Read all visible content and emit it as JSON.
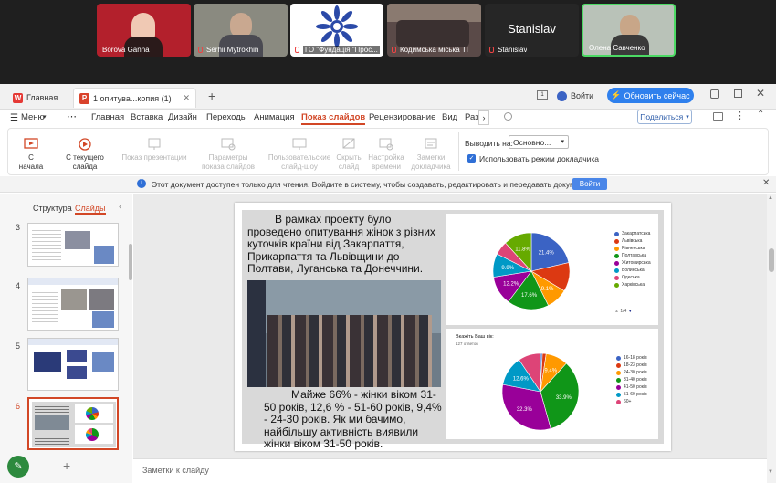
{
  "conference": {
    "participants": [
      {
        "name": "Borova Ganna",
        "bg": "#b3202c"
      },
      {
        "name": "Serhii Mytrokhin",
        "bg": "#8a8a80"
      },
      {
        "name": "ГО \"Фундація \"Прос...",
        "bg": "#ffffff"
      },
      {
        "name": "Кодимська міська ТГ",
        "bg": "#5a4a48"
      },
      {
        "name": "Stanislav",
        "bg": "#262626",
        "big": "Stanislav"
      },
      {
        "name": "Олена Савченко",
        "bg": "#b9c2b8"
      }
    ]
  },
  "tabs": [
    {
      "label": "Главная"
    },
    {
      "label": "1 опитува...копия (1)"
    }
  ],
  "login": "Войти",
  "update": "Обновить сейчас",
  "ribbon_tabs": [
    "Меню",
    "Главная",
    "Вставка",
    "Дизайн",
    "Переходы",
    "Анимация",
    "Показ слайдов",
    "Рецензирование",
    "Вид",
    "Раз"
  ],
  "share": "Поделиться",
  "ribbon": {
    "from_start": "С начала",
    "from_current": "С текущего слайда",
    "present": "Показ презентации",
    "params": [
      "Параметры",
      "показа слайдов"
    ],
    "custom": [
      "Пользовательские",
      "слайд-шоу"
    ],
    "hide": [
      "Скрыть",
      "слайд"
    ],
    "timings": [
      "Настройка",
      "времени"
    ],
    "notes": [
      "Заметки",
      "докладчика"
    ],
    "output_label": "Выводить на:",
    "output_value": "Основно...",
    "presenter": "Использовать режим докладчика"
  },
  "info": "Этот документ доступен только для чтения. Войдите в систему, чтобы создавать, редактировать и передавать документы.",
  "info_button": "Войти",
  "panel": {
    "structure": "Структура",
    "slides": "Слайды",
    "numbers": [
      "3",
      "4",
      "5",
      "6"
    ]
  },
  "slide": {
    "top_text": "В рамках проекту було проведено опитування жінок з різних куточків країни від Закарпаття, Прикарпаття та Львівщини до Полтави, Луганська та Донеччини.",
    "bottom_text": "Майже 66% - жінки віком 31-50 років, 12,6 % - 51-60 років, 9,4% - 24-30 років. Як ми бачимо, найбільшу активність виявили жінки віком 31-50 років.",
    "chart1": {
      "slices": [
        {
          "name": "Закарпатська",
          "value": 21.4,
          "color": "#3b63c4",
          "label": "21.4%"
        },
        {
          "name": "Львівська",
          "value": 12.2,
          "color": "#dc3912",
          "label": ""
        },
        {
          "name": "Рівненська",
          "value": 9.1,
          "color": "#ff9900",
          "label": "9.1%"
        },
        {
          "name": "Полтавська",
          "value": 17.6,
          "color": "#109618",
          "label": "17.6%"
        },
        {
          "name": "Житомирська",
          "value": 12.2,
          "color": "#990099",
          "label": "12.2%"
        },
        {
          "name": "Волинська",
          "value": 9.9,
          "color": "#0099c6",
          "label": "9.9%"
        },
        {
          "name": "Одеська",
          "value": 5.8,
          "color": "#dd4477",
          "label": ""
        },
        {
          "name": "Харківська",
          "value": 11.8,
          "color": "#66aa00",
          "label": "11.8%"
        }
      ],
      "pager": "1/4"
    },
    "chart2": {
      "title": "Вкажіть Ваш вік:",
      "subtitle": "127 ответов",
      "slices": [
        {
          "name": "16-18 років",
          "value": 0.8,
          "color": "#3b63c4",
          "label": ""
        },
        {
          "name": "18-23 років",
          "value": 1.6,
          "color": "#dc3912",
          "label": ""
        },
        {
          "name": "24-30 років",
          "value": 9.4,
          "color": "#ff9900",
          "label": "9.4%"
        },
        {
          "name": "31-40 років",
          "value": 33.9,
          "color": "#109618",
          "label": "33.9%"
        },
        {
          "name": "41-50 років",
          "value": 32.3,
          "color": "#990099",
          "label": "32.3%"
        },
        {
          "name": "51-60 років",
          "value": 12.6,
          "color": "#0099c6",
          "label": "12.6%"
        },
        {
          "name": "60+",
          "value": 9.4,
          "color": "#dd4477",
          "label": ""
        }
      ]
    }
  },
  "notes": "Заметки к слайду"
}
